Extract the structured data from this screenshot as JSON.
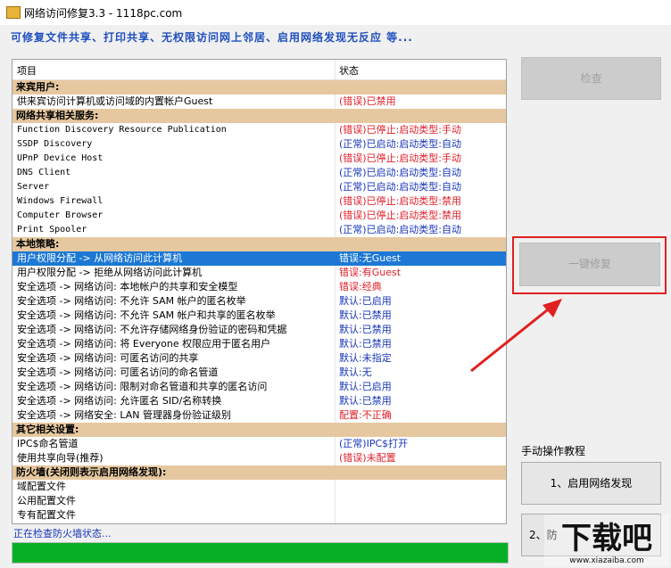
{
  "window": {
    "title": "网络访问修复3.3 - 1118pc.com"
  },
  "subtitle": "可修复文件共享、打印共享、无权限访问网上邻居、启用网络发现无反应  等...",
  "table": {
    "headers": [
      "项目",
      "状态"
    ],
    "rows": [
      {
        "type": "group",
        "item": "来宾用户:",
        "status": ""
      },
      {
        "type": "row",
        "item": "供来宾访问计算机或访问域的内置帐户Guest",
        "status": "(错误)已禁用",
        "color": "red",
        "mono": false
      },
      {
        "type": "group",
        "item": "网络共享相关服务:",
        "status": ""
      },
      {
        "type": "row",
        "item": "Function Discovery Resource Publication",
        "status": "(错误)已停止:启动类型:手动",
        "color": "red",
        "mono": true
      },
      {
        "type": "row",
        "item": "SSDP Discovery",
        "status": "(正常)已启动:启动类型:自动",
        "color": "blue",
        "mono": true
      },
      {
        "type": "row",
        "item": "UPnP Device Host",
        "status": "(错误)已停止:启动类型:手动",
        "color": "red",
        "mono": true
      },
      {
        "type": "row",
        "item": "DNS Client",
        "status": "(正常)已启动:启动类型:自动",
        "color": "blue",
        "mono": true
      },
      {
        "type": "row",
        "item": "Server",
        "status": "(正常)已启动:启动类型:自动",
        "color": "blue",
        "mono": true
      },
      {
        "type": "row",
        "item": "Windows Firewall",
        "status": "(错误)已停止:启动类型:禁用",
        "color": "red",
        "mono": true
      },
      {
        "type": "row",
        "item": "Computer Browser",
        "status": "(错误)已停止:启动类型:禁用",
        "color": "red",
        "mono": true
      },
      {
        "type": "row",
        "item": "Print Spooler",
        "status": "(正常)已启动:启动类型:自动",
        "color": "blue",
        "mono": true
      },
      {
        "type": "group",
        "item": "本地策略:",
        "status": ""
      },
      {
        "type": "row",
        "item": "用户权限分配 -> 从网络访问此计算机",
        "status": "错误:无Guest",
        "color": "red",
        "mono": false,
        "selected": true
      },
      {
        "type": "row",
        "item": "用户权限分配 -> 拒绝从网络访问此计算机",
        "status": "错误:有Guest",
        "color": "red",
        "mono": false
      },
      {
        "type": "row",
        "item": "安全选项 -> 网络访问: 本地帐户的共享和安全模型",
        "status": "错误:经典",
        "color": "red",
        "mono": false
      },
      {
        "type": "row",
        "item": "安全选项 -> 网络访问: 不允许 SAM 帐户的匿名枚举",
        "status": "默认:已启用",
        "color": "blue",
        "mono": false
      },
      {
        "type": "row",
        "item": "安全选项 -> 网络访问: 不允许 SAM 帐户和共享的匿名枚举",
        "status": "默认:已禁用",
        "color": "blue",
        "mono": false
      },
      {
        "type": "row",
        "item": "安全选项 -> 网络访问: 不允许存储网络身份验证的密码和凭据",
        "status": "默认:已禁用",
        "color": "blue",
        "mono": false
      },
      {
        "type": "row",
        "item": "安全选项 -> 网络访问: 将 Everyone 权限应用于匿名用户",
        "status": "默认:已禁用",
        "color": "blue",
        "mono": false
      },
      {
        "type": "row",
        "item": "安全选项 -> 网络访问: 可匿名访问的共享",
        "status": "默认:未指定",
        "color": "blue",
        "mono": false
      },
      {
        "type": "row",
        "item": "安全选项 -> 网络访问: 可匿名访问的命名管道",
        "status": "默认:无",
        "color": "blue",
        "mono": false
      },
      {
        "type": "row",
        "item": "安全选项 -> 网络访问: 限制对命名管道和共享的匿名访问",
        "status": "默认:已启用",
        "color": "blue",
        "mono": false
      },
      {
        "type": "row",
        "item": "安全选项 -> 网络访问: 允许匿名 SID/名称转换",
        "status": "默认:已禁用",
        "color": "blue",
        "mono": false
      },
      {
        "type": "row",
        "item": "安全选项 -> 网络安全: LAN 管理器身份验证级别",
        "status": "配置:不正确",
        "color": "red",
        "mono": false
      },
      {
        "type": "group",
        "item": "其它相关设置:",
        "status": ""
      },
      {
        "type": "row",
        "item": "IPC$命名管道",
        "status": "(正常)IPC$打开",
        "color": "blue",
        "mono": false
      },
      {
        "type": "row",
        "item": "使用共享向导(推荐)",
        "status": "(错误)未配置",
        "color": "red",
        "mono": false
      },
      {
        "type": "group",
        "item": "防火墙(关闭则表示启用网络发现):",
        "status": ""
      },
      {
        "type": "row",
        "item": "域配置文件",
        "status": "",
        "color": "blue",
        "mono": false
      },
      {
        "type": "row",
        "item": "公用配置文件",
        "status": "",
        "color": "blue",
        "mono": false
      },
      {
        "type": "row",
        "item": "专有配置文件",
        "status": "",
        "color": "blue",
        "mono": false
      }
    ]
  },
  "status_text": "正在检查防火墙状态...",
  "progress_fraction": 1.0,
  "buttons": {
    "check": "检查",
    "repair": "一键修复",
    "manual_label": "手动操作教程",
    "tutorial1": "1、启用网络发现",
    "tutorial2": "2、防"
  },
  "watermark": {
    "text": "下载吧",
    "url": "www.xiazaiba.com"
  },
  "colors": {
    "error": "#e0202a",
    "ok": "#1535b8",
    "group_bg": "#e6c8a0",
    "selected_bg": "#1c78d4",
    "progress": "#06b025"
  }
}
